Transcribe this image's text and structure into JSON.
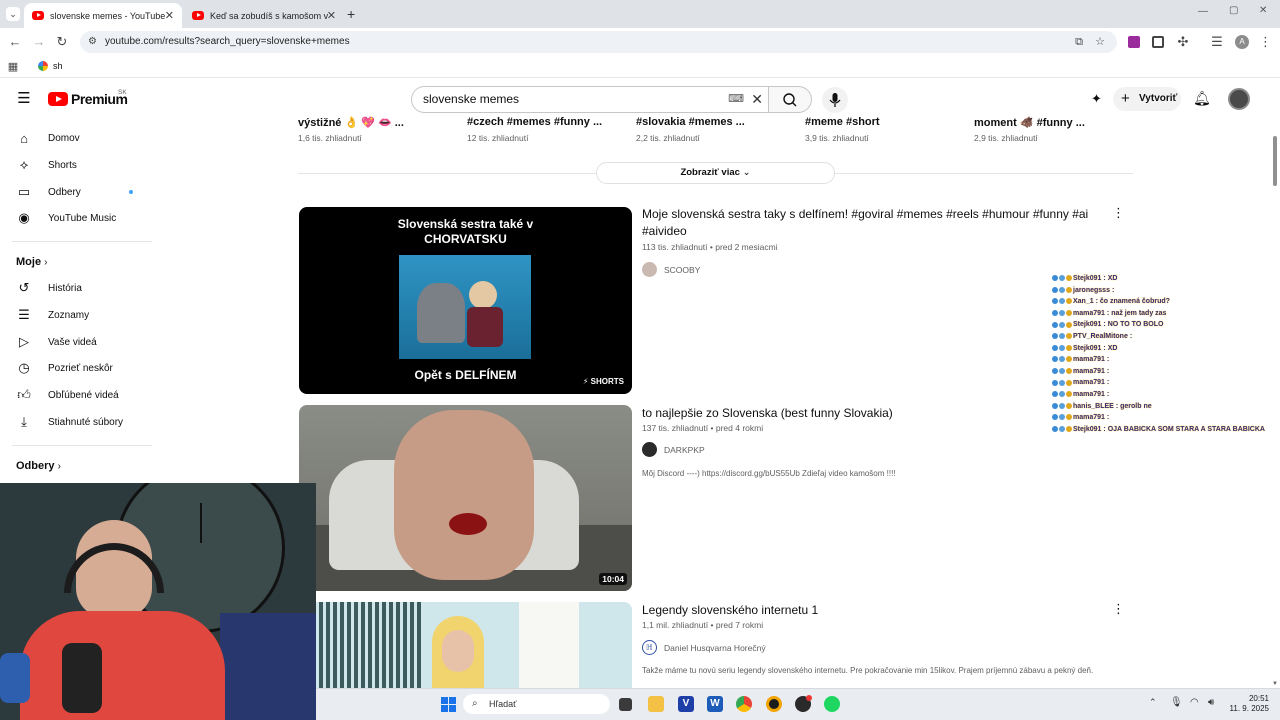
{
  "browser": {
    "tabs": [
      {
        "title": "slovenske memes - YouTube",
        "active": true
      },
      {
        "title": "Keď sa zobudíš s kamošom v p"
      }
    ],
    "new_tab": "+",
    "url": "youtube.com/results?search_query=slovenske+memes",
    "bookmark": "sh"
  },
  "header": {
    "logo_text": "Premium",
    "region": "SK",
    "search_value": "slovenske memes",
    "create_label": "Vytvoriť"
  },
  "sidebar": {
    "main": [
      {
        "label": "Domov",
        "icon": "home-icon"
      },
      {
        "label": "Shorts",
        "icon": "shorts-icon"
      },
      {
        "label": "Odbery",
        "icon": "subscriptions-icon"
      },
      {
        "label": "YouTube Music",
        "icon": "music-icon"
      }
    ],
    "you_heading": "Moje",
    "you": [
      {
        "label": "História",
        "icon": "history-icon"
      },
      {
        "label": "Zoznamy",
        "icon": "playlists-icon"
      },
      {
        "label": "Vaše videá",
        "icon": "your-videos-icon"
      },
      {
        "label": "Pozrieť neskôr",
        "icon": "watch-later-icon"
      },
      {
        "label": "Obľúbené videá",
        "icon": "liked-icon"
      },
      {
        "label": "Stiahnuté súbory",
        "icon": "downloads-icon"
      }
    ],
    "subs_heading": "Odbery"
  },
  "shorts_row": [
    {
      "title": "výstižné 👌 💖 👄 ...",
      "views": "1,6 tis. zhliadnutí"
    },
    {
      "title": "#czech #memes #funny ...",
      "views": "12 tis. zhliadnutí"
    },
    {
      "title": "#slovakia #memes ...",
      "views": "2,2 tis. zhliadnutí"
    },
    {
      "title": "#meme #short",
      "views": "3,9 tis. zhliadnutí"
    },
    {
      "title": "moment 🐗 #funny ...",
      "views": "2,9 tis. zhliadnutí"
    }
  ],
  "show_more": "Zobraziť viac",
  "videos": [
    {
      "title": "Moje slovenská sestra taky s delfínem! #goviral #memes #reels #humour #funny #ai #aivideo",
      "meta": "113 tis. zhliadnutí • pred 2 mesiacmi",
      "channel": "SCOOBY",
      "thumb_top_text": "Slovenská sestra také v CHORVATSKU",
      "thumb_bottom_text": "Opět s DELFÍNEM",
      "badge": "SHORTS"
    },
    {
      "title": "to najlepšie zo Slovenska (best funny Slovakia)",
      "meta": "137 tis. zhliadnutí • pred 4 rokmi",
      "channel": "DARKPKP",
      "description": "Môj Discord ----) https://discord.gg/bUS55Ub Zdieľaj video kamošom !!!!",
      "duration": "10:04"
    },
    {
      "title": "Legendy slovenského internetu 1",
      "meta": "1,1 mil. zhliadnutí • pred 7 rokmi",
      "channel": "Daniel Husqvarna Horečný",
      "description": "Takže máme tu novú seriu legendy slovenského internetu. Pre pokračovanie min 15likov. Prajem príjemnú zábavu a pekný deň."
    }
  ],
  "chat": [
    {
      "user": "Stejk091",
      "msg": ": XD"
    },
    {
      "user": "jaronegsss",
      "msg": ":"
    },
    {
      "user": "Xan_1",
      "msg": ": čo znamená čobrud?"
    },
    {
      "user": "mama791",
      "msg": ": naž jem tady zas"
    },
    {
      "user": "Stejk091",
      "msg": ": NO TO TO BOLO"
    },
    {
      "user": "PTV_RealMitone",
      "msg": ":"
    },
    {
      "user": "Stejk091",
      "msg": ": XD"
    },
    {
      "user": "mama791",
      "msg": ":"
    },
    {
      "user": "mama791",
      "msg": ":"
    },
    {
      "user": "mama791",
      "msg": ":"
    },
    {
      "user": "mama791",
      "msg": ":"
    },
    {
      "user": "hanis_BLEE",
      "msg": ": gerolb ne"
    },
    {
      "user": "mama791",
      "msg": ":"
    },
    {
      "user": "Stejk091",
      "msg": ": OJA BABICKA SOM STARA A STARA BABICKA"
    }
  ],
  "taskbar": {
    "search_placeholder": "Hľadať",
    "time": "20:51",
    "date": "11. 9. 2025"
  },
  "colors": {
    "yt_red": "#ff0000",
    "chat_text": "#3a2a7a",
    "chat_glow": "#ffe36b"
  }
}
